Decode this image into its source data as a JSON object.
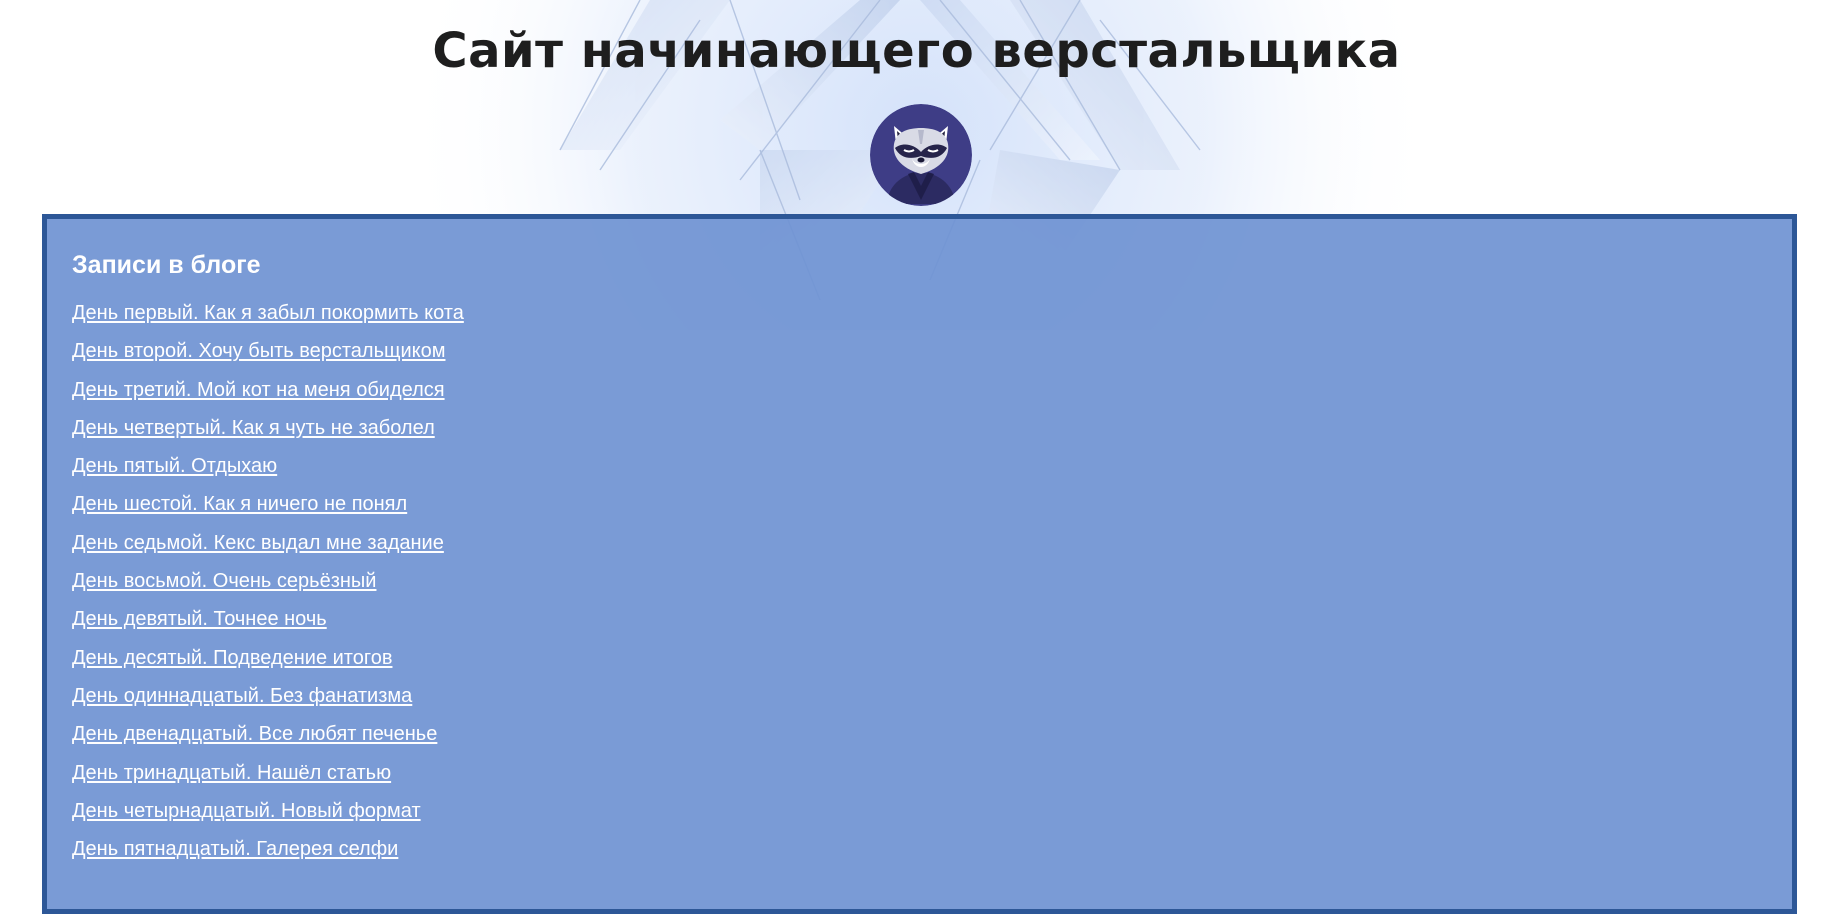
{
  "page": {
    "title": "Сайт начинающего верстальщика"
  },
  "header": {
    "title": "Сайт начинающего верстальщика",
    "avatar_icon": "raccoon-avatar-icon"
  },
  "blog": {
    "heading": "Записи в блоге",
    "posts": [
      {
        "label": "День первый. Как я забыл покормить кота"
      },
      {
        "label": "День второй. Хочу быть верстальщиком"
      },
      {
        "label": "День третий. Мой кот на меня обиделся"
      },
      {
        "label": "День четвертый. Как я чуть не заболел"
      },
      {
        "label": "День пятый. Отдыхаю"
      },
      {
        "label": "День шестой. Как я ничего не понял"
      },
      {
        "label": "День седьмой. Кекс выдал мне задание"
      },
      {
        "label": "День восьмой. Очень серьёзный"
      },
      {
        "label": "День девятый. Точнее ночь"
      },
      {
        "label": "День десятый. Подведение итогов"
      },
      {
        "label": "День одиннадцатый. Без фанатизма"
      },
      {
        "label": "День двенадцатый. Все любят печенье"
      },
      {
        "label": "День тринадцатый. Нашёл статью"
      },
      {
        "label": "День четырнадцатый. Новый формат"
      },
      {
        "label": "День пятнадцатый. Галерея селфи"
      }
    ]
  },
  "colors": {
    "panel_background": "#7b99d5",
    "panel_border": "#2d5797",
    "link_text": "#ffffff",
    "title_text": "#1e1e1e"
  }
}
